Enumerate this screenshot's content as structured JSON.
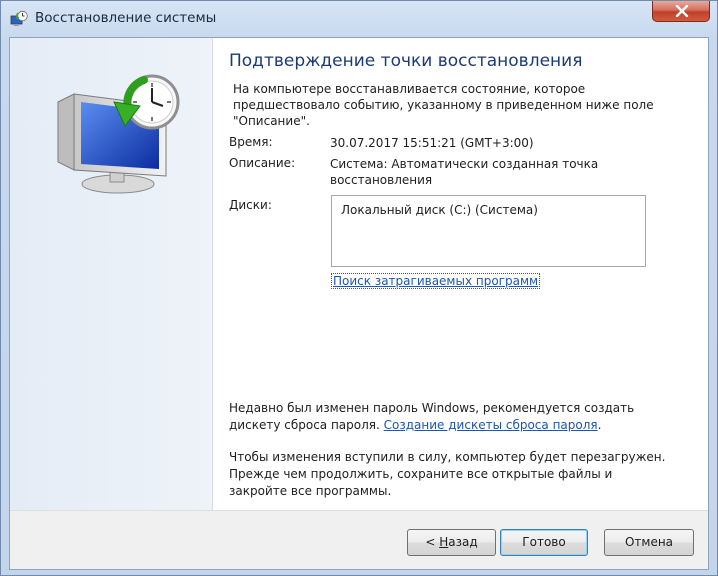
{
  "window": {
    "title": "Восстановление системы",
    "close_label": "✕"
  },
  "content": {
    "heading": "Подтверждение точки восстановления",
    "intro": "На компьютере восстанавливается состояние, которое предшествовало событию, указанному в приведенном ниже поле \"Описание\".",
    "time_label": "Время:",
    "time_value": "30.07.2017 15:51:21 (GMT+3:00)",
    "description_label": "Описание:",
    "description_value": "Система: Автоматически созданная точка восстановления",
    "disks_label": "Диски:",
    "disks": [
      "Локальный диск (C:) (Система)"
    ],
    "scan_link": "Поиск затрагиваемых программ",
    "password_text": "Недавно был изменен пароль Windows, рекомендуется создать дискету сброса пароля.",
    "password_link": "Создание дискеты сброса пароля",
    "password_suffix": ".",
    "restart_text": "Чтобы изменения вступили в силу, компьютер будет перезагружен. Прежде чем продолжить, сохраните все открытые файлы и закройте все программы."
  },
  "footer": {
    "back_prefix": "< ",
    "back_mnemonic": "Н",
    "back_rest": "азад",
    "finish_label": "Готово",
    "cancel_label": "Отмена"
  },
  "colors": {
    "heading": "#1c3a77",
    "link": "#1a56b7",
    "close_button": "#c0402a"
  },
  "icons": {
    "title": "system-restore-icon",
    "sidebar": "system-restore-clock-monitor-icon",
    "close": "close-icon"
  }
}
